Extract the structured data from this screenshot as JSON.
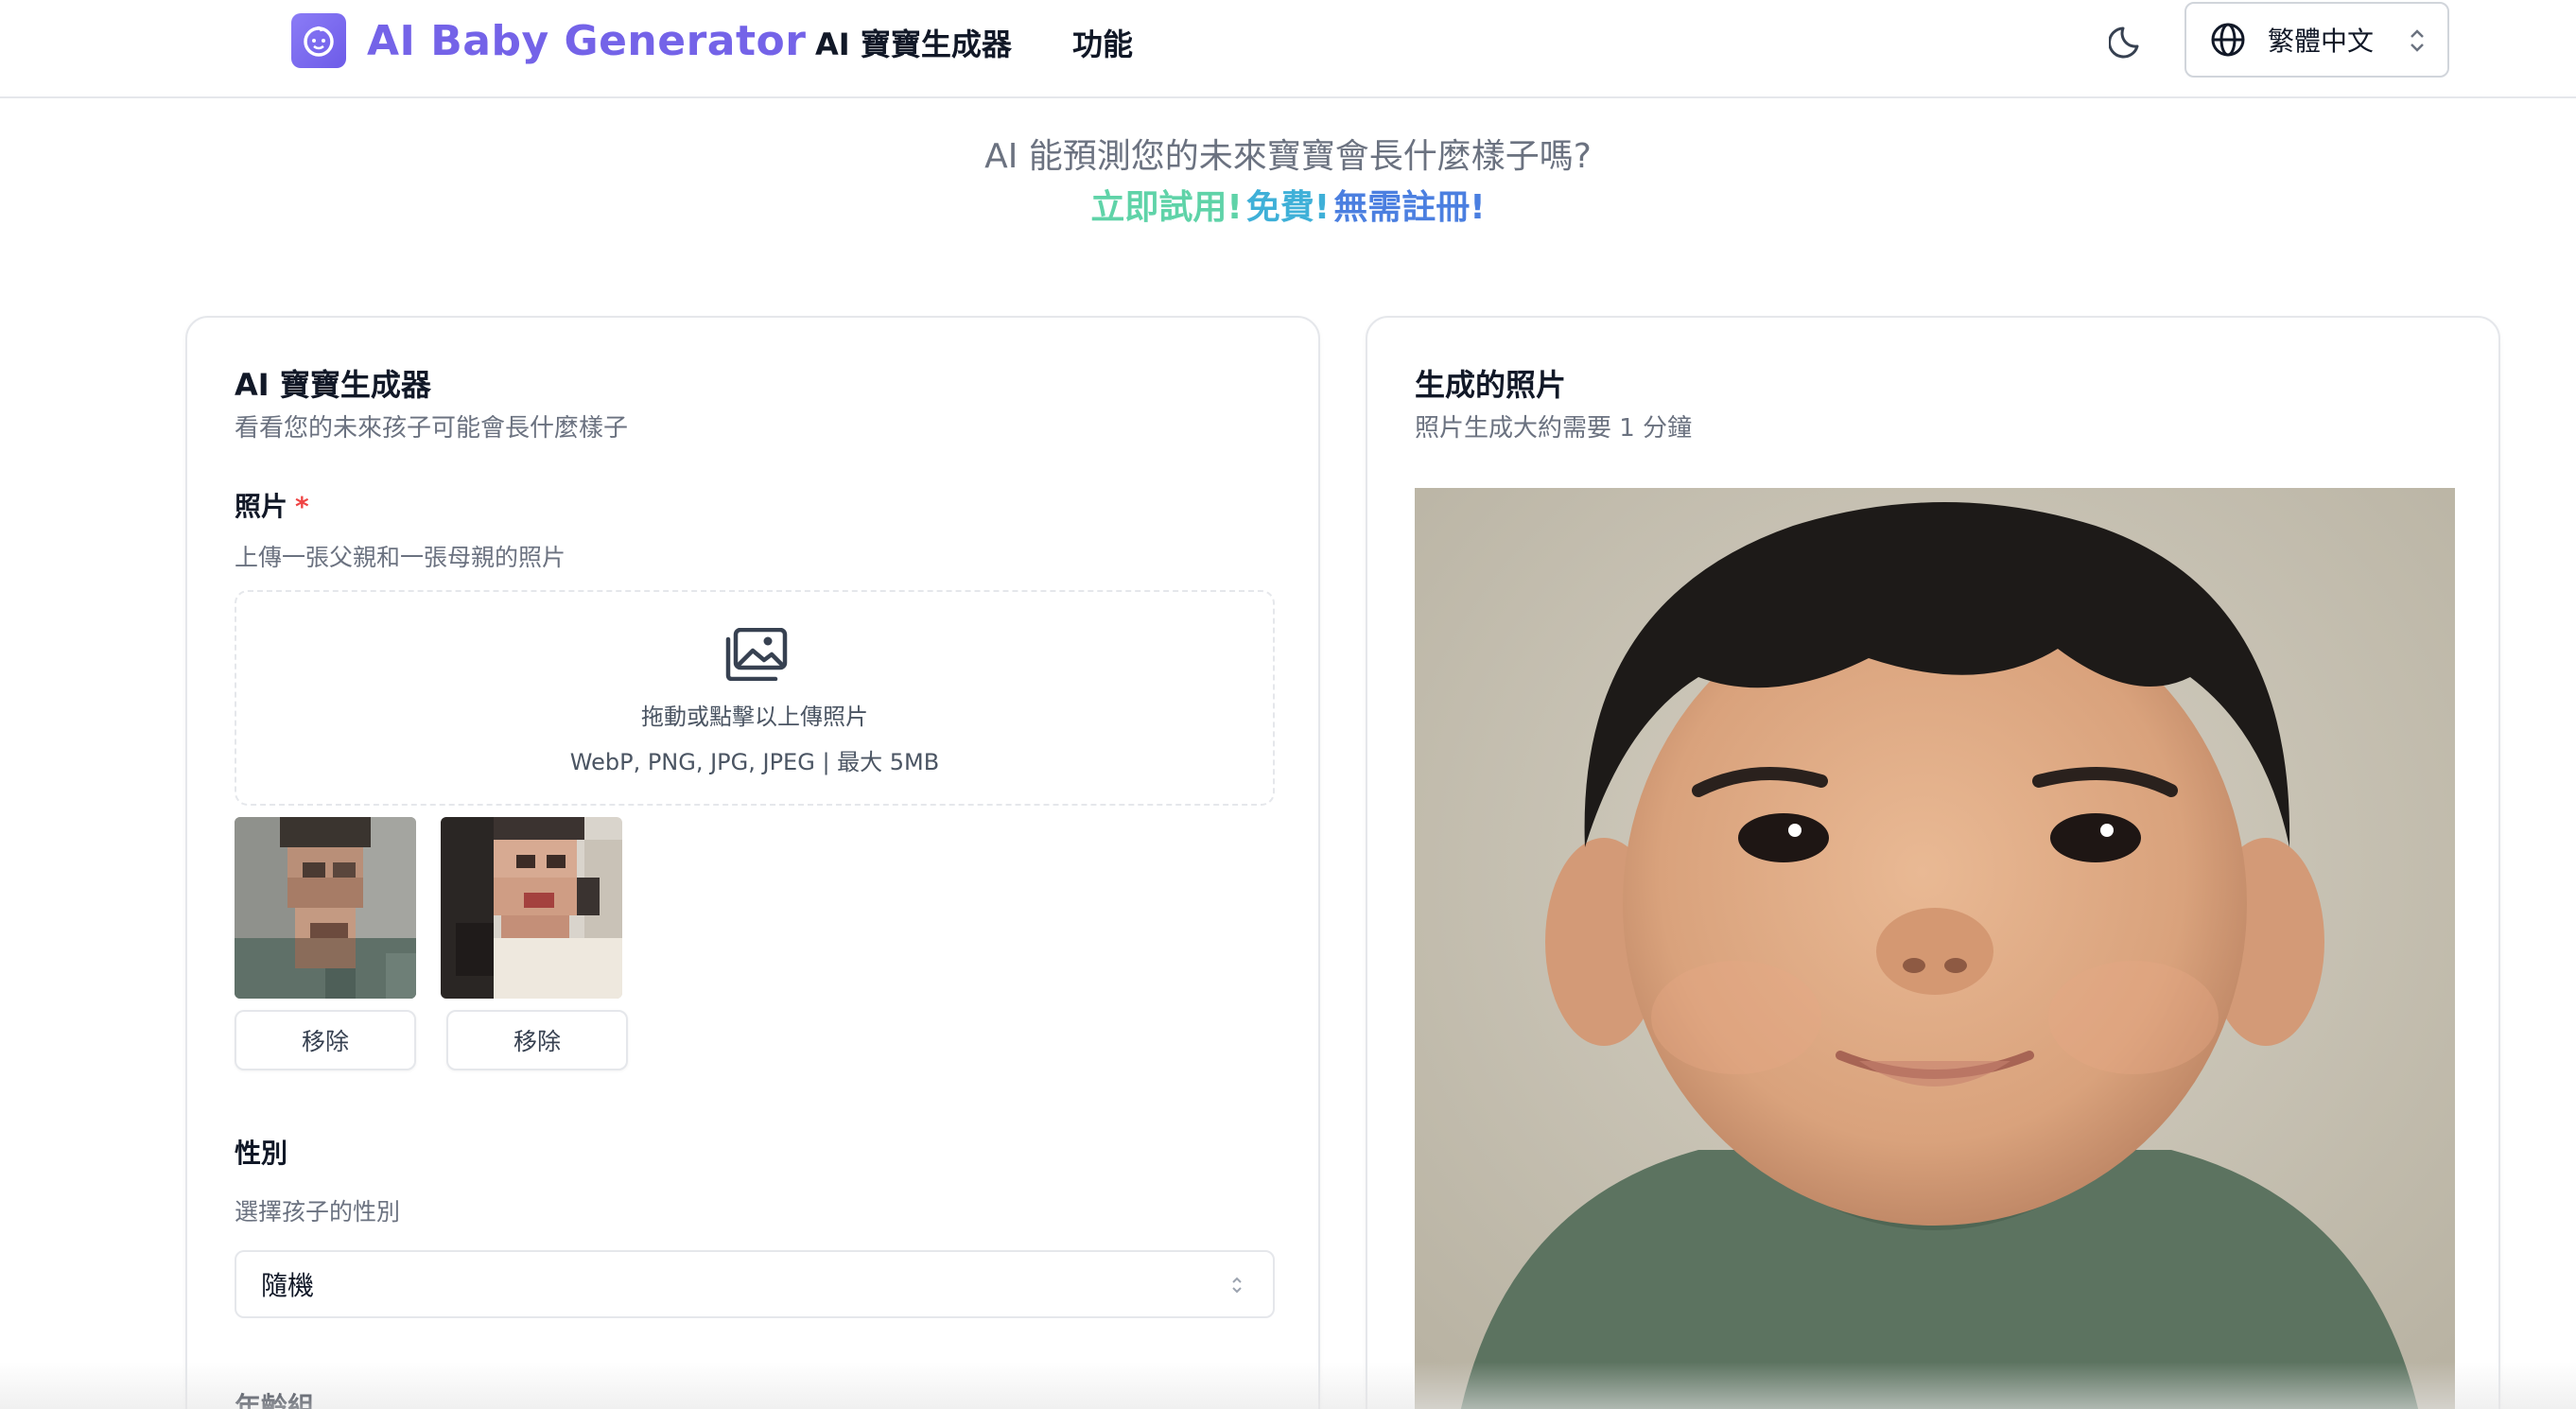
{
  "header": {
    "brand": "AI Baby Generator",
    "nav": [
      "AI 寶寶生成器",
      "功能"
    ],
    "language": "繁體中文"
  },
  "hero": {
    "question": "AI 能預測您的未來寶寶會長什麼樣子嗎?",
    "cta_parts": [
      "立即試用!",
      "免費!",
      "無需註冊!"
    ]
  },
  "form_card": {
    "title": "AI 寶寶生成器",
    "subtitle": "看看您的未來孩子可能會長什麼樣子",
    "photos": {
      "label": "照片",
      "required_mark": "*",
      "description": "上傳一張父親和一張母親的照片",
      "dropzone_text": "拖動或點擊以上傳照片",
      "dropzone_hint": "WebP, PNG, JPG, JPEG | 最大 5MB",
      "uploaded": [
        {
          "remove_label": "移除"
        },
        {
          "remove_label": "移除"
        }
      ]
    },
    "gender": {
      "label": "性別",
      "description": "選擇孩子的性別",
      "selected": "隨機"
    },
    "age_group": {
      "label": "年齡組"
    }
  },
  "result_card": {
    "title": "生成的照片",
    "subtitle": "照片生成大約需要 1 分鐘"
  },
  "colors": {
    "brand": "#7463e8",
    "cta_green": "#5fd3a8",
    "cta_cyan": "#3fb0d8",
    "cta_blue": "#4b7fe0",
    "required": "#ef4444"
  }
}
